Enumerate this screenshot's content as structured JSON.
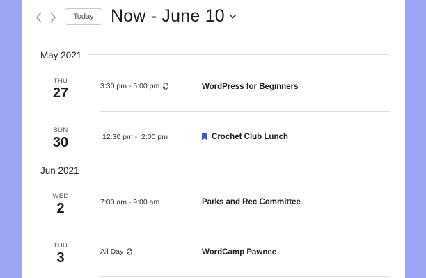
{
  "header": {
    "today_label": "Today",
    "range_label": "Now - June 10"
  },
  "months": [
    {
      "label": "May 2021",
      "days": [
        {
          "dow": "THU",
          "day": "27",
          "event": {
            "time": "3:30 pm - 5:00 pm",
            "recurring": true,
            "featured": false,
            "title": "WordPress for Beginners"
          }
        },
        {
          "dow": "SUN",
          "day": "30",
          "event": {
            "time": "12:30 pm -  2:00 pm",
            "recurring": false,
            "featured": true,
            "title": "Crochet Club Lunch"
          }
        }
      ]
    },
    {
      "label": "Jun 2021",
      "days": [
        {
          "dow": "WED",
          "day": "2",
          "event": {
            "time": "7:00 am - 9:00 am",
            "recurring": false,
            "featured": false,
            "title": "Parks and Rec Committee"
          }
        },
        {
          "dow": "THU",
          "day": "3",
          "event": {
            "time": "All Day",
            "recurring": true,
            "featured": false,
            "title": "WordCamp Pawnee"
          }
        }
      ]
    }
  ],
  "colors": {
    "background": "#9da4f4",
    "featured_accent": "#3f51e0"
  }
}
